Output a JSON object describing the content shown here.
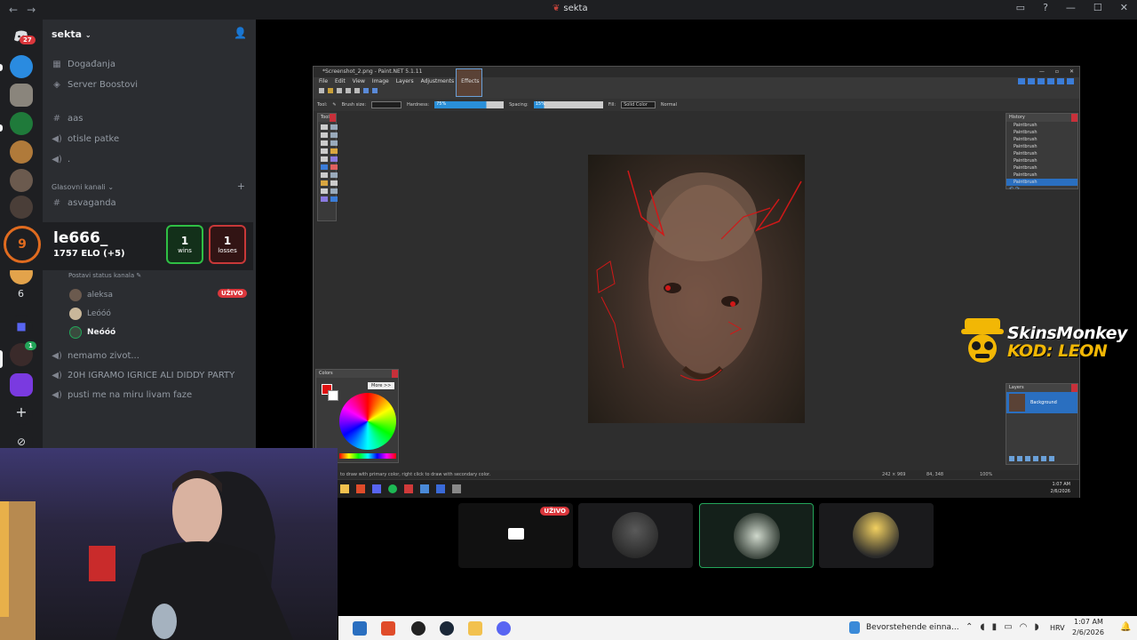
{
  "window": {
    "title": "sekta",
    "nav_back": "←",
    "nav_forward": "→",
    "controls": [
      "▭",
      "?",
      "—",
      "☐",
      "✕"
    ]
  },
  "guilds": {
    "notification_count": "27",
    "unread_badge": "1"
  },
  "server": {
    "name": "sekta",
    "menu_items": [
      {
        "label": "Događanja",
        "icon": "calendar-icon"
      },
      {
        "label": "Server Boostovi",
        "icon": "boost-icon"
      }
    ],
    "text_channels": [
      {
        "label": "aas",
        "icon": "hash-icon"
      },
      {
        "label": "otisle patke",
        "icon": "speaker-icon"
      },
      {
        "label": ".",
        "icon": "speaker-icon"
      }
    ],
    "category": "Glasovni kanali",
    "voice_channels_top": [
      {
        "label": "asvaganda",
        "icon": "hash-icon"
      }
    ],
    "status_prompt": "Postavi status kanala",
    "members": [
      {
        "name": "aleksa",
        "live": "UŽIVO"
      },
      {
        "name": "Leóóó",
        "live": ""
      },
      {
        "name": "Neóóó",
        "live": ""
      }
    ],
    "voice_channels_bottom": [
      {
        "label": "nemamo zivot...",
        "icon": "speaker-icon"
      },
      {
        "label": "20H IGRAMO IGRICE ALI DIDDY PARTY",
        "icon": "speaker-icon"
      },
      {
        "label": "pusti me na miru livam faze",
        "icon": "speaker-icon"
      }
    ],
    "guild_label_six": "6"
  },
  "elo_overlay": {
    "level": "9",
    "username": "le666_",
    "elo": "1757 ELO (+5)",
    "wins_value": "1",
    "wins_label": "wins",
    "losses_value": "1",
    "losses_label": "losses"
  },
  "paintnet": {
    "title": "*Screenshot_2.png - Paint.NET 5.1.11",
    "menu": [
      "File",
      "Edit",
      "View",
      "Image",
      "Layers",
      "Adjustments",
      "Effects"
    ],
    "toolbar": {
      "tool_label": "Tool:",
      "brush_size_label": "Brush size:",
      "hardness_label": "Hardness:",
      "hardness_value": "75%",
      "spacing_label": "Spacing:",
      "spacing_value": "15%",
      "fill_label": "Fill:",
      "fill_value": "Solid Color",
      "blend_value": "Normal"
    },
    "history": {
      "title": "History",
      "items": [
        "Paintbrush",
        "Paintbrush",
        "Paintbrush",
        "Paintbrush",
        "Paintbrush",
        "Paintbrush",
        "Paintbrush",
        "Paintbrush",
        "Paintbrush"
      ]
    },
    "colors": {
      "title": "Colors",
      "more": "More >>"
    },
    "layers": {
      "title": "Layers",
      "layer_name": "Background"
    },
    "status": {
      "hint": "to draw with primary color, right click to draw with secondary color.",
      "selection": "242 × 969",
      "pointer": "84, 348",
      "zoom": "100%",
      "time": "1:07 AM",
      "date": "2/6/2026"
    }
  },
  "stream_tiles": {
    "live_badge": "UŽIVO"
  },
  "sponsor": {
    "line1": "SkinsMonkey",
    "line2": "KOD: LEON"
  },
  "taskbar": {
    "notification": "Bevorstehende einna...",
    "language": "HRV",
    "time": "1:07 AM",
    "date": "2/6/2026"
  },
  "colors": {
    "discord_bg": "#2b2d31",
    "win_green": "#2fbf44",
    "loss_red": "#c73838",
    "live_red": "#da373c",
    "sponsor_yellow": "#f2b705"
  }
}
